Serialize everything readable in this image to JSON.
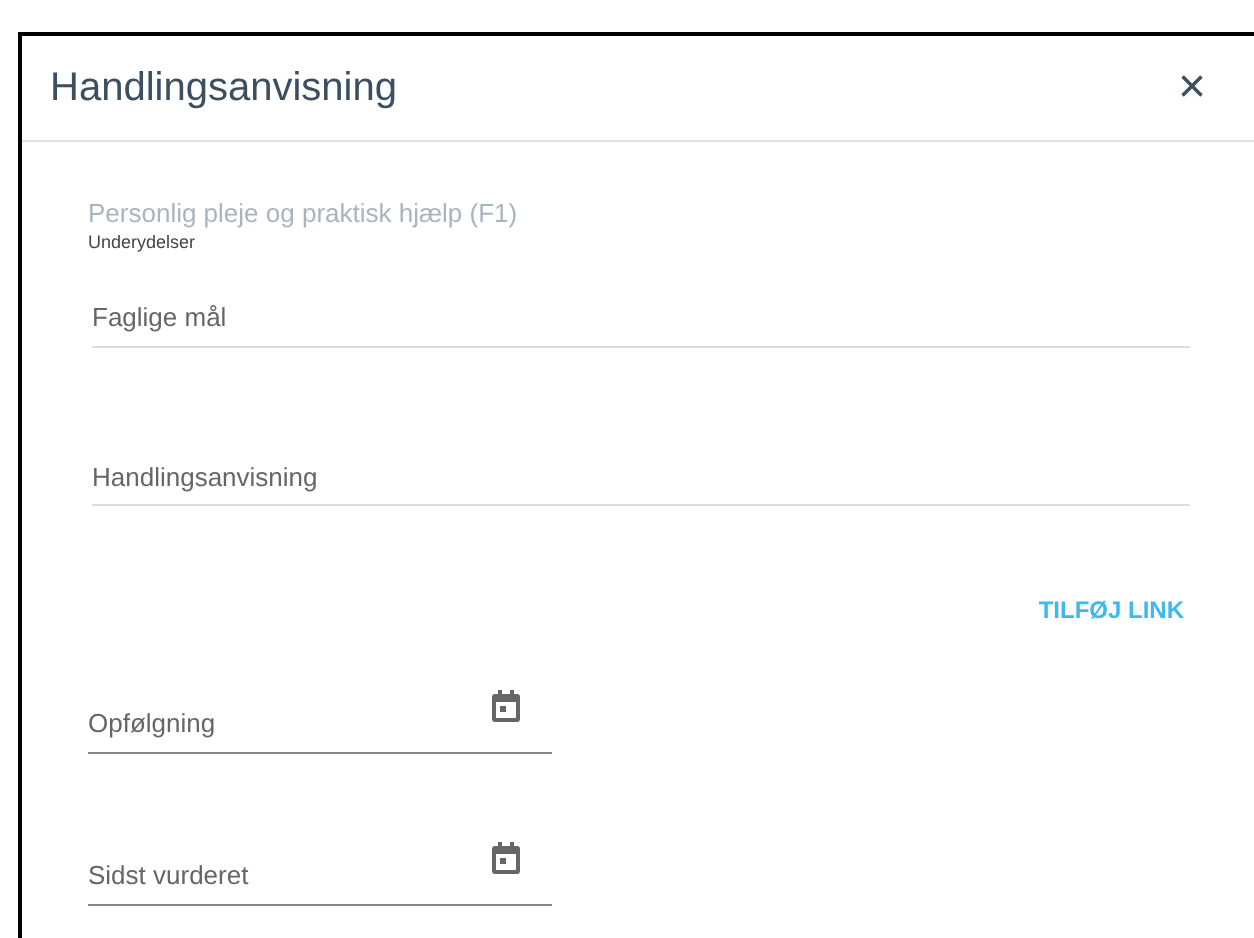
{
  "dialog": {
    "title": "Handlingsanvisning",
    "close": "×"
  },
  "section": {
    "title": "Personlig pleje og praktisk hjælp (F1)",
    "subtitle": "Underydelser"
  },
  "text_fields": [
    {
      "placeholder": "Faglige mål"
    },
    {
      "placeholder": "Handlingsanvisning"
    }
  ],
  "add_link_button": "TILFØJ LINK",
  "date_fields": [
    {
      "placeholder": "Opfølgning"
    },
    {
      "placeholder": "Sidst vurderet"
    }
  ]
}
